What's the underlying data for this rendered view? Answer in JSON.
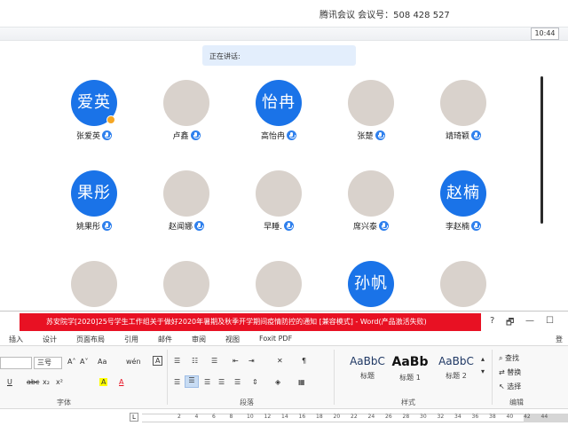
{
  "meeting": {
    "title": "腾讯会议 会议号：508 428 527",
    "clock": "10:44",
    "speaking_label": "正在讲话:"
  },
  "participants": [
    {
      "name": "张爱英",
      "avatar_text": "爱英",
      "kind": "text",
      "host": true
    },
    {
      "name": "卢鑫",
      "avatar_text": "",
      "kind": "photo"
    },
    {
      "name": "高怡冉",
      "avatar_text": "怡冉",
      "kind": "text"
    },
    {
      "name": "张楚",
      "avatar_text": "",
      "kind": "photo"
    },
    {
      "name": "靖琦颖",
      "avatar_text": "",
      "kind": "photo"
    },
    {
      "name": "姚果彤",
      "avatar_text": "果彤",
      "kind": "text"
    },
    {
      "name": "赵闻娜",
      "avatar_text": "",
      "kind": "photo"
    },
    {
      "name": "早睡.",
      "avatar_text": "",
      "kind": "photo"
    },
    {
      "name": "席兴泰",
      "avatar_text": "",
      "kind": "photo"
    },
    {
      "name": "李赵楠",
      "avatar_text": "赵楠",
      "kind": "text"
    },
    {
      "name": "",
      "avatar_text": "",
      "kind": "photo"
    },
    {
      "name": "",
      "avatar_text": "",
      "kind": "photo"
    },
    {
      "name": "",
      "avatar_text": "",
      "kind": "photo"
    },
    {
      "name": "",
      "avatar_text": "孙帆",
      "kind": "text"
    },
    {
      "name": "",
      "avatar_text": "",
      "kind": "photo"
    }
  ],
  "word": {
    "title": "苏安院学[2020]25号学生工作组关于做好2020年暑期及秋季开学期间疫情防控的通知 [兼容模式] - Word(产品激活失败)",
    "window_buttons": [
      "?",
      "🗗",
      "—",
      "☐"
    ],
    "tabs": [
      "插入",
      "设计",
      "页面布局",
      "引用",
      "邮件",
      "审阅",
      "视图",
      "Foxit PDF",
      "登"
    ],
    "font_size": "三号",
    "font_group_label": "字体",
    "paragraph_group_label": "段落",
    "styles_group_label": "样式",
    "edit_group_label": "编辑",
    "styles": [
      {
        "preview": "AaBbC",
        "name": "标题"
      },
      {
        "preview": "AaBb",
        "name": "标题 1"
      },
      {
        "preview": "AaBbC",
        "name": "标题 2"
      }
    ],
    "edit_items": [
      "查找",
      "替换",
      "选择"
    ],
    "font_tools": [
      "A˄",
      "A˅",
      "Aa",
      "wén",
      "A"
    ],
    "format_tools": [
      "U",
      "abc",
      "x₂",
      "x²",
      "A",
      "A"
    ],
    "ruler_corner": "L",
    "ruler_numbers": [
      "2",
      "4",
      "6",
      "8",
      "10",
      "12",
      "14",
      "16",
      "18",
      "20",
      "22",
      "24",
      "26",
      "28",
      "30",
      "32",
      "34",
      "36",
      "38",
      "40",
      "42",
      "44"
    ]
  },
  "colors": {
    "accent": "#1a73e8",
    "word_title_red": "#e81123",
    "mic": "#2f80ed"
  }
}
